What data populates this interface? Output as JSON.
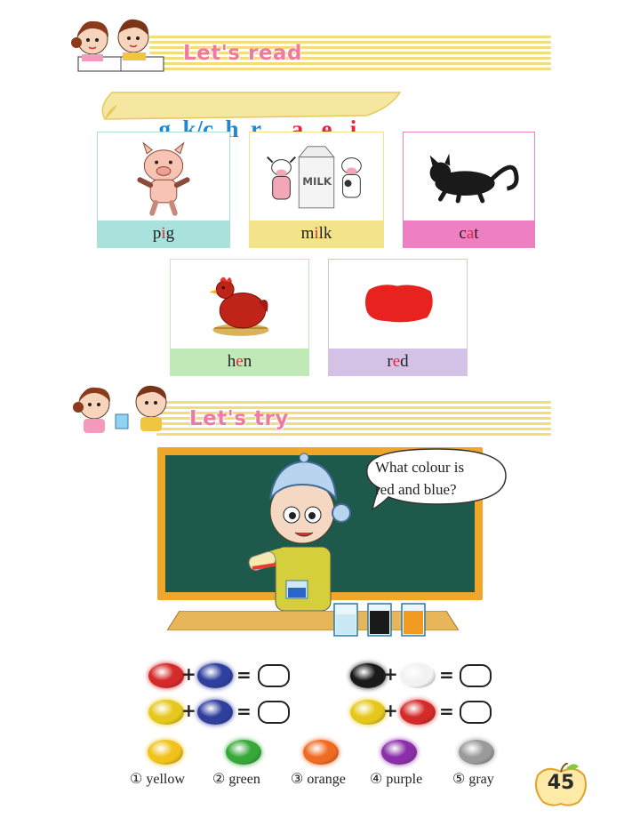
{
  "read_section": {
    "title": "Let's read"
  },
  "phonics": {
    "letters": [
      {
        "text": "g",
        "kind": "consonant"
      },
      {
        "text": "k/c",
        "kind": "consonant"
      },
      {
        "text": "h",
        "kind": "consonant"
      },
      {
        "text": "r",
        "kind": "consonant"
      },
      {
        "text": "a",
        "kind": "vowel"
      },
      {
        "text": "e",
        "kind": "vowel"
      },
      {
        "text": "i",
        "kind": "vowel"
      }
    ],
    "colors": {
      "consonant": "#1e88d6",
      "vowel": "#e8263a"
    }
  },
  "cards": [
    {
      "pre": "p",
      "hl": "i",
      "post": "g",
      "color": "#a9e2dc",
      "border": "#a9e2dc",
      "picture": "pig-icon"
    },
    {
      "pre": "m",
      "hl": "i",
      "post": "lk",
      "color": "#f3e48c",
      "border": "#f3e48c",
      "picture": "milk-icon"
    },
    {
      "pre": "c",
      "hl": "a",
      "post": "t",
      "color": "#ee7fc2",
      "border": "#ee7fc2",
      "picture": "cat-icon"
    },
    {
      "pre": "h",
      "hl": "e",
      "post": "n",
      "color": "#bfe9b6",
      "border": "#bfe9b6",
      "picture": "hen-icon"
    },
    {
      "pre": "r",
      "hl": "e",
      "post": "d",
      "color": "#d3c2e6",
      "border": "#d3c2e6",
      "picture": "red-paint-icon"
    }
  ],
  "try_section": {
    "title": "Let's try"
  },
  "bubble": {
    "line1": "What colour is",
    "line2": "red and blue?"
  },
  "equations": [
    {
      "a": "#d42a2a",
      "b": "#2f3f9e"
    },
    {
      "a": "#1a1a1a",
      "b": "#f2f2f2"
    },
    {
      "a": "#e6c81c",
      "b": "#2f3f9e"
    },
    {
      "a": "#e6c81c",
      "b": "#d42a2a"
    }
  ],
  "operators": {
    "plus": "+",
    "equals": "="
  },
  "options": [
    {
      "num": "①",
      "label": "yellow",
      "color": "#f0c21a"
    },
    {
      "num": "②",
      "label": "green",
      "color": "#38a83a"
    },
    {
      "num": "③",
      "label": "orange",
      "color": "#ef6a22"
    },
    {
      "num": "④",
      "label": "purple",
      "color": "#8a2fa8"
    },
    {
      "num": "⑤",
      "label": "gray",
      "color": "#9a9a9a"
    }
  ],
  "page_number": "45"
}
